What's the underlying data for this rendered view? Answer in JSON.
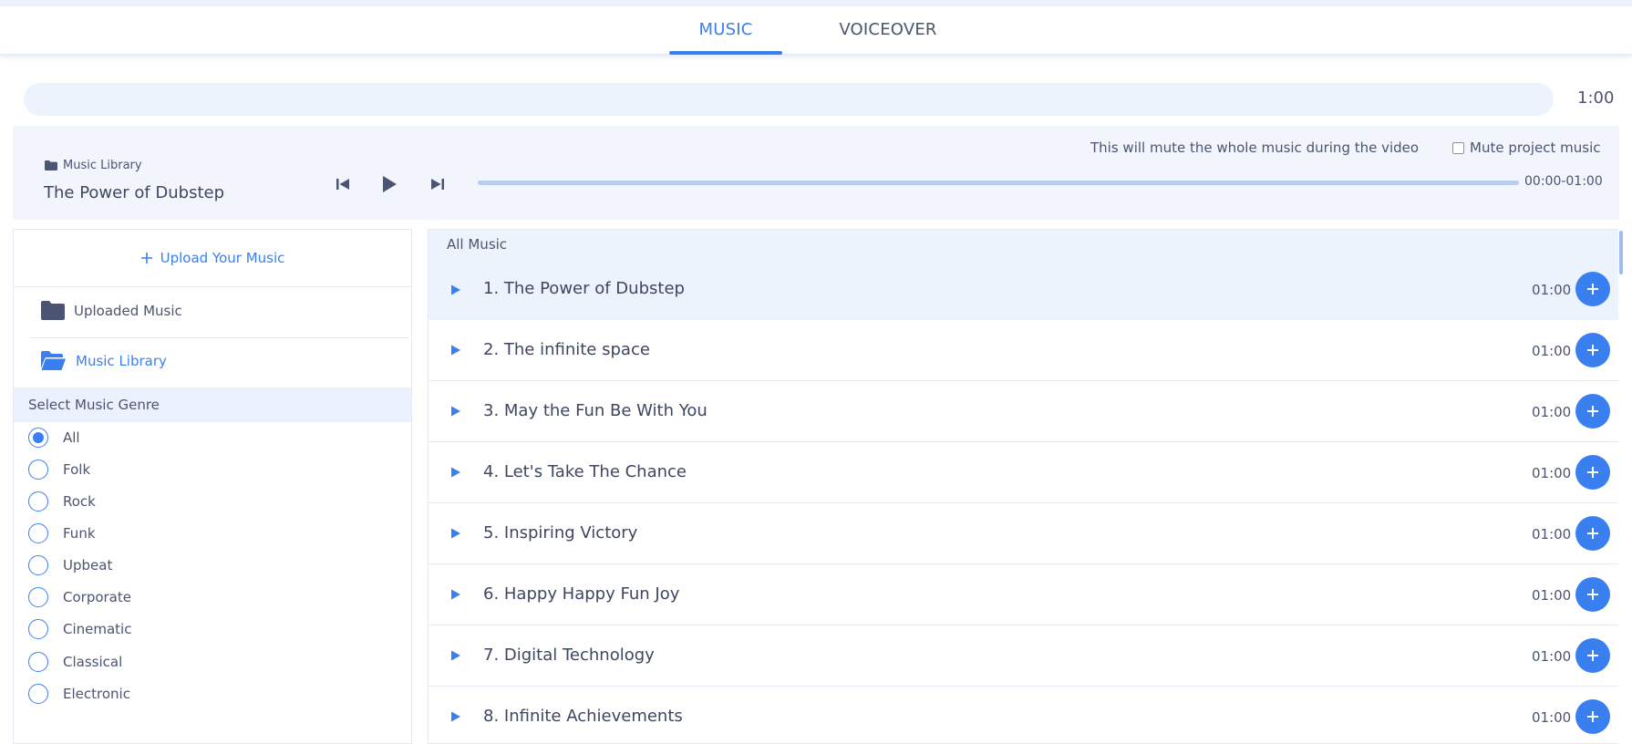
{
  "tabs": [
    {
      "label": "MUSIC",
      "active": true
    },
    {
      "label": "VOICEOVER",
      "active": false
    }
  ],
  "timeline": {
    "duration": "1:00"
  },
  "player": {
    "library_label": "Music Library",
    "track_title": "The Power of Dubstep",
    "time_range": "00:00-01:00",
    "mute_note": "This will mute the whole music during the video",
    "mute_label": "Mute project music",
    "mute_checked": false,
    "progress": 0
  },
  "sidebar": {
    "upload_label": "Upload Your Music",
    "folders": [
      {
        "label": "Uploaded Music",
        "active": false
      },
      {
        "label": "Music Library",
        "active": true
      }
    ],
    "genre_header": "Select Music Genre",
    "genres": [
      {
        "label": "All",
        "selected": true
      },
      {
        "label": "Folk",
        "selected": false
      },
      {
        "label": "Rock",
        "selected": false
      },
      {
        "label": "Funk",
        "selected": false
      },
      {
        "label": "Upbeat",
        "selected": false
      },
      {
        "label": "Corporate",
        "selected": false
      },
      {
        "label": "Cinematic",
        "selected": false
      },
      {
        "label": "Classical",
        "selected": false
      },
      {
        "label": "Electronic",
        "selected": false
      }
    ]
  },
  "music_list": {
    "header": "All Music",
    "tracks": [
      {
        "title": "1. The Power of Dubstep",
        "duration": "01:00",
        "active": true
      },
      {
        "title": "2. The infinite space",
        "duration": "01:00",
        "active": false
      },
      {
        "title": "3. May the Fun Be With You",
        "duration": "01:00",
        "active": false
      },
      {
        "title": "4. Let's Take The Chance",
        "duration": "01:00",
        "active": false
      },
      {
        "title": "5. Inspiring Victory",
        "duration": "01:00",
        "active": false
      },
      {
        "title": "6. Happy Happy Fun Joy",
        "duration": "01:00",
        "active": false
      },
      {
        "title": "7. Digital Technology",
        "duration": "01:00",
        "active": false
      },
      {
        "title": "8. Infinite Achievements",
        "duration": "01:00",
        "active": false
      }
    ]
  },
  "colors": {
    "accent": "#3a7ff0",
    "text": "#4b5470",
    "panel_bg": "#f2f6fc"
  }
}
